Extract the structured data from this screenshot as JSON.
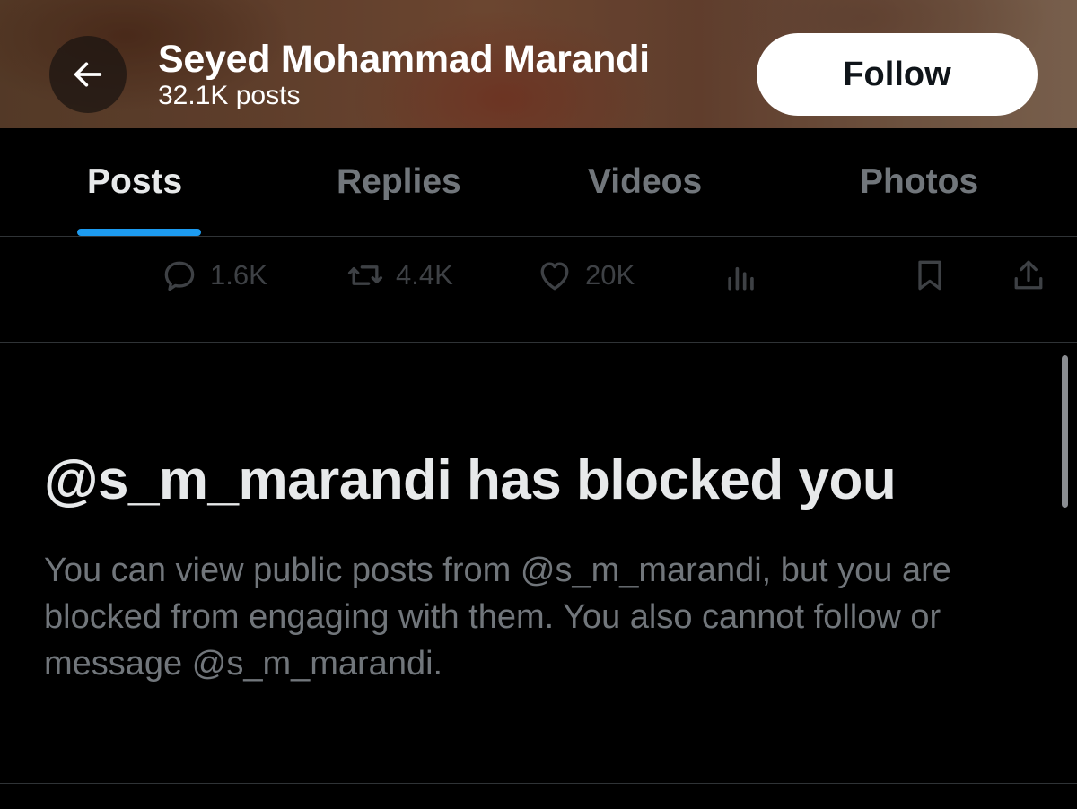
{
  "header": {
    "name": "Seyed Mohammad Marandi",
    "post_count": "32.1K posts",
    "follow_label": "Follow"
  },
  "tabs": [
    {
      "label": "Posts",
      "active": true
    },
    {
      "label": "Replies",
      "active": false
    },
    {
      "label": "Videos",
      "active": false
    },
    {
      "label": "Photos",
      "active": false
    }
  ],
  "actions": {
    "replies": {
      "icon": "reply-icon",
      "count": "1.6K"
    },
    "reposts": {
      "icon": "repost-icon",
      "count": "4.4K"
    },
    "likes": {
      "icon": "heart-icon",
      "count": "20K"
    },
    "views": {
      "icon": "views-icon"
    },
    "bookmark": {
      "icon": "bookmark-icon"
    },
    "share": {
      "icon": "share-icon"
    }
  },
  "blocked": {
    "title": "@s_m_marandi has blocked you",
    "message": "You can view public posts from @s_m_marandi, but you are blocked from engaging with them. You also cannot follow or message @s_m_marandi."
  },
  "colors": {
    "accent": "#1d9bf0",
    "background": "#000000",
    "muted_text": "#71767b",
    "primary_text": "#e7e9ea"
  }
}
